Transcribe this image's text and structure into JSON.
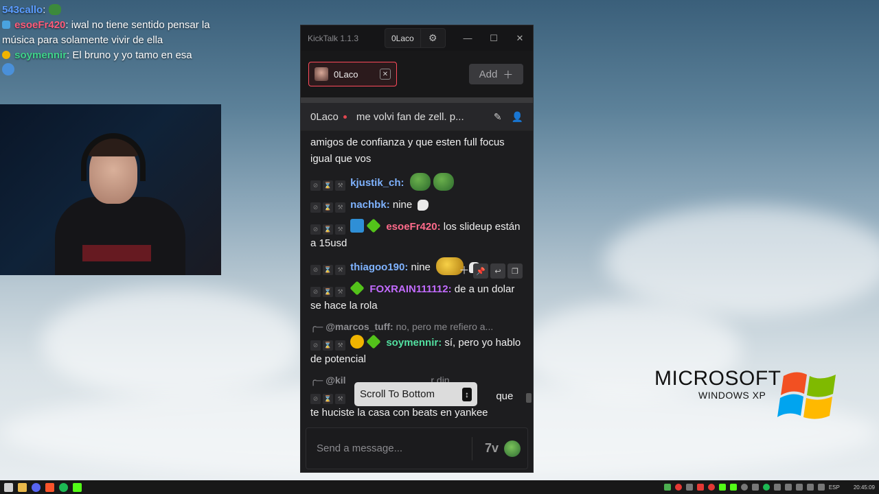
{
  "overlay_chat": [
    {
      "user": "543callo",
      "user_color": "#5b9cff",
      "text": ""
    },
    {
      "user": "esoeFr420",
      "user_color": "#ff5c7a",
      "text": "iwal no tiene sentido pensar la música para solamente vivir de ella"
    },
    {
      "user": "soymennir",
      "user_color": "#3fd38a",
      "text": "El bruno y yo tamo en esa"
    }
  ],
  "app": {
    "title": "KickTalk 1.1.3",
    "user_button": "0Laco"
  },
  "tabs": [
    {
      "label": "0Laco"
    }
  ],
  "add_button": "Add",
  "channel": {
    "name": "0Laco",
    "stream_title": "me volvi fan de zell. p..."
  },
  "messages": [
    {
      "user": "",
      "user_color": "#f0f0f0",
      "text": "amigos de confianza y que esten full focus igual que vos",
      "show_mod": false
    },
    {
      "user": "kjustik_ch",
      "user_color": "#7fb3ff",
      "text": "",
      "emotes": 2,
      "show_mod": true
    },
    {
      "user": "nachbk",
      "user_color": "#7fb3ff",
      "text": "nine",
      "show_mod": true
    },
    {
      "user": "esoeFr420",
      "user_color": "#ff6b8b",
      "text": "los slideup están a 15usd",
      "show_mod": true
    },
    {
      "user": "thiagoo190",
      "user_color": "#7fb3ff",
      "text": "nine",
      "show_mod": true
    },
    {
      "user": "FOXRAIN111112",
      "user_color": "#c26bff",
      "text": "de a un dolar se hace la rola",
      "show_mod": true
    },
    {
      "reply_to": "@marcos_tuff:",
      "reply_text": "no, pero me refiero a...",
      "user": "soymennir",
      "user_color": "#52e0a0",
      "text": "sí, pero yo hablo de potencial",
      "show_mod": true
    },
    {
      "reply_to": "@kil",
      "reply_text": "r din...",
      "user": "",
      "user_color": "#f0f0f0",
      "text": "que te huciste la casa con beats en yankee",
      "show_mod": true
    }
  ],
  "scroll_to_bottom": "Scroll To Bottom",
  "input": {
    "placeholder": "Send a message..."
  },
  "desktop": {
    "logo_main": "MICROSOFT",
    "logo_sub": "WINDOWS XP"
  },
  "taskbar": {
    "lang": "ESP",
    "time": "20:45:09"
  },
  "colors": {
    "kick_accent": "#ff4b5c",
    "app_bg": "#1d1d1f"
  }
}
